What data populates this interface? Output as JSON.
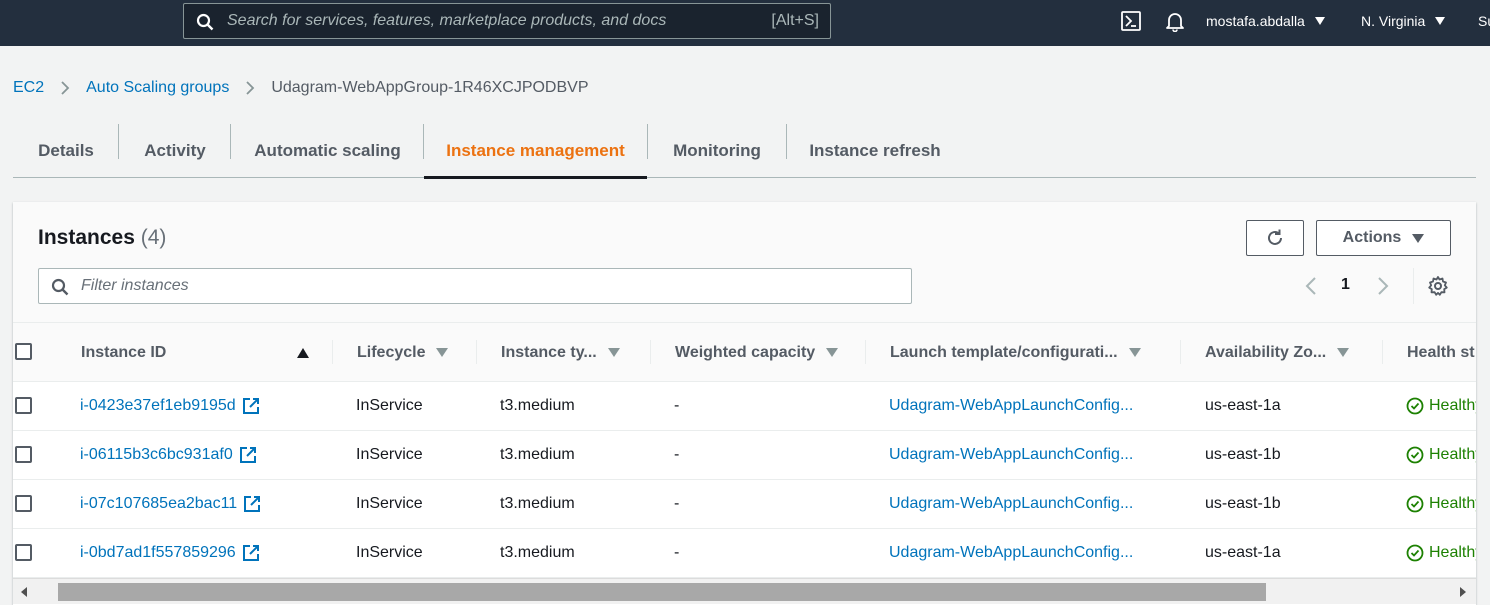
{
  "topnav": {
    "search_placeholder": "Search for services, features, marketplace products, and docs",
    "search_shortcut": "[Alt+S]",
    "terminal_icon": "cloudshell-icon",
    "bell_icon": "bell-icon",
    "user": "mostafa.abdalla",
    "region": "N. Virginia",
    "support_partial": "Su"
  },
  "breadcrumb": {
    "items": [
      "EC2",
      "Auto Scaling groups"
    ],
    "current": "Udagram-WebAppGroup-1R46XCJPODBVP"
  },
  "tabs": [
    "Details",
    "Activity",
    "Automatic scaling",
    "Instance management",
    "Monitoring",
    "Instance refresh"
  ],
  "active_tab": "Instance management",
  "instances": {
    "title": "Instances",
    "count": "(4)",
    "refresh_icon": "refresh-icon",
    "actions_label": "Actions",
    "filter_placeholder": "Filter instances",
    "page": "1",
    "settings_icon": "gear-icon"
  },
  "table": {
    "columns": [
      "Instance ID",
      "Lifecycle",
      "Instance ty...",
      "Weighted capacity",
      "Launch template/configurati...",
      "Availability Zo...",
      "Health st"
    ],
    "rows": [
      {
        "id": "i-0423e37ef1eb9195d",
        "lifecycle": "InService",
        "type": "t3.medium",
        "weight": "-",
        "launch": "Udagram-WebAppLaunchConfig...",
        "az": "us-east-1a",
        "health": "Healthy"
      },
      {
        "id": "i-06115b3c6bc931af0",
        "lifecycle": "InService",
        "type": "t3.medium",
        "weight": "-",
        "launch": "Udagram-WebAppLaunchConfig...",
        "az": "us-east-1b",
        "health": "Healthy"
      },
      {
        "id": "i-07c107685ea2bac11",
        "lifecycle": "InService",
        "type": "t3.medium",
        "weight": "-",
        "launch": "Udagram-WebAppLaunchConfig...",
        "az": "us-east-1b",
        "health": "Healthy"
      },
      {
        "id": "i-0bd7ad1f557859296",
        "lifecycle": "InService",
        "type": "t3.medium",
        "weight": "-",
        "launch": "Udagram-WebAppLaunchConfig...",
        "az": "us-east-1a",
        "health": "Healthy"
      }
    ]
  },
  "colors": {
    "nav_bg": "#232f3e",
    "link": "#0073bb",
    "active_tab": "#ec7211",
    "healthy": "#1d8102"
  }
}
